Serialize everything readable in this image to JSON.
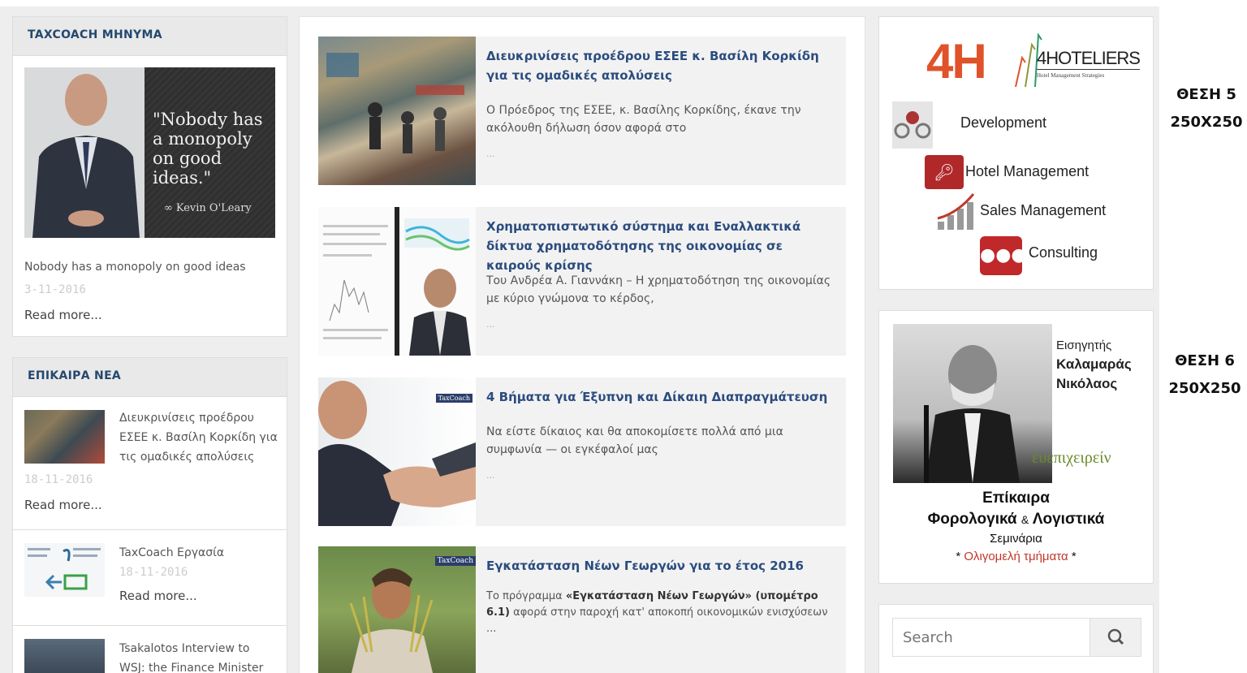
{
  "left": {
    "message_widget": {
      "title": "TAXCOACH ΜΗΝΥΜΑ",
      "quote_text": "\"Nobody has a monopoly on good ideas.\"",
      "quote_author": "Kevin O'Leary",
      "caption": "Nobody has a monopoly on good ideas",
      "date": "3-11-2016",
      "read_more": "Read more..."
    },
    "news_widget": {
      "title": "ΕΠΙΚΑΙΡΑ ΝΕΑ",
      "items": [
        {
          "title": "Διευκρινίσεις προέδρου ΕΣΕΕ κ. Βασίλη Κορκίδη για τις ομαδικές απολύσεις",
          "date": "18-11-2016",
          "read_more": "Read more..."
        },
        {
          "title": "TaxCoach Εργασία",
          "date": "18-11-2016",
          "read_more": "Read more..."
        },
        {
          "title": "Tsakalotos Interview to WSJ: the Finance Minister"
        }
      ]
    }
  },
  "posts": [
    {
      "title": "Διευκρινίσεις προέδρου ΕΣΕΕ κ. Βασίλη Κορκίδη για τις ομαδικές απολύσεις",
      "excerpt": "Ο Πρόεδρος της ΕΣΕΕ, κ. Βασίλης Κορκίδης, έκανε την ακόλουθη δήλωση όσον αφορά στο",
      "more": "..."
    },
    {
      "title": "Χρηματοπιστωτικό σύστημα και Εναλλακτικά δίκτυα χρηματοδότησης της οικονομίας σε καιρούς κρίσης",
      "excerpt": "Του Ανδρέα Α. Γιαννάκη – Η χρηματοδότηση της οικονομίας με κύριο γνώμονα το κέρδος,",
      "more": "..."
    },
    {
      "title": "4 Βήματα για Έξυπνη και Δίκαιη Διαπραγμάτευση",
      "excerpt": "Να είστε δίκαιος και θα αποκομίσετε πολλά από μια συμφωνία — οι εγκέφαλοί μας",
      "more": "...",
      "badge": "TaxCoach"
    },
    {
      "title": "Εγκατάσταση Νέων Γεωργών για το έτος 2016",
      "excerpt_lead": "Το πρόγραμμα",
      "excerpt_bold": "«Εγκατάσταση Νέων Γεωργών» (υπομέτρο 6.1)",
      "excerpt_rest": "αφορά στην παροχή κατ' αποκοπή οικονομικών ενισχύσεων ...",
      "badge": "TaxCoach"
    }
  ],
  "ads": {
    "hoteliers": {
      "logo_big": "4H",
      "logo_word": "4HOTELIERS",
      "logo_tagline": "Hotel Management Strategies",
      "services": [
        "Development",
        "Hotel Management",
        "Sales Management",
        "Consulting"
      ]
    },
    "seminar": {
      "speaker_label": "Εισηγητής",
      "speaker_name_1": "Καλαμαράς",
      "speaker_name_2": "Νικόλαος",
      "brand": "ευεπιχειρείν",
      "line1": "Επίκαιρα",
      "line2a": "Φορολογικά",
      "line2b": "&",
      "line2c": "Λογιστικά",
      "line3": "Σεμινάρια",
      "line4": "Ολιγομελή τμήματα"
    },
    "position_labels": [
      {
        "name": "ΘΕΣΗ 5",
        "size": "250X250"
      },
      {
        "name": "ΘΕΣΗ 6",
        "size": "250X250"
      }
    ]
  },
  "search": {
    "placeholder": "Search"
  },
  "colors": {
    "accent": "#2b4c7e",
    "red": "#c0392b",
    "panel": "#eeeeee"
  }
}
